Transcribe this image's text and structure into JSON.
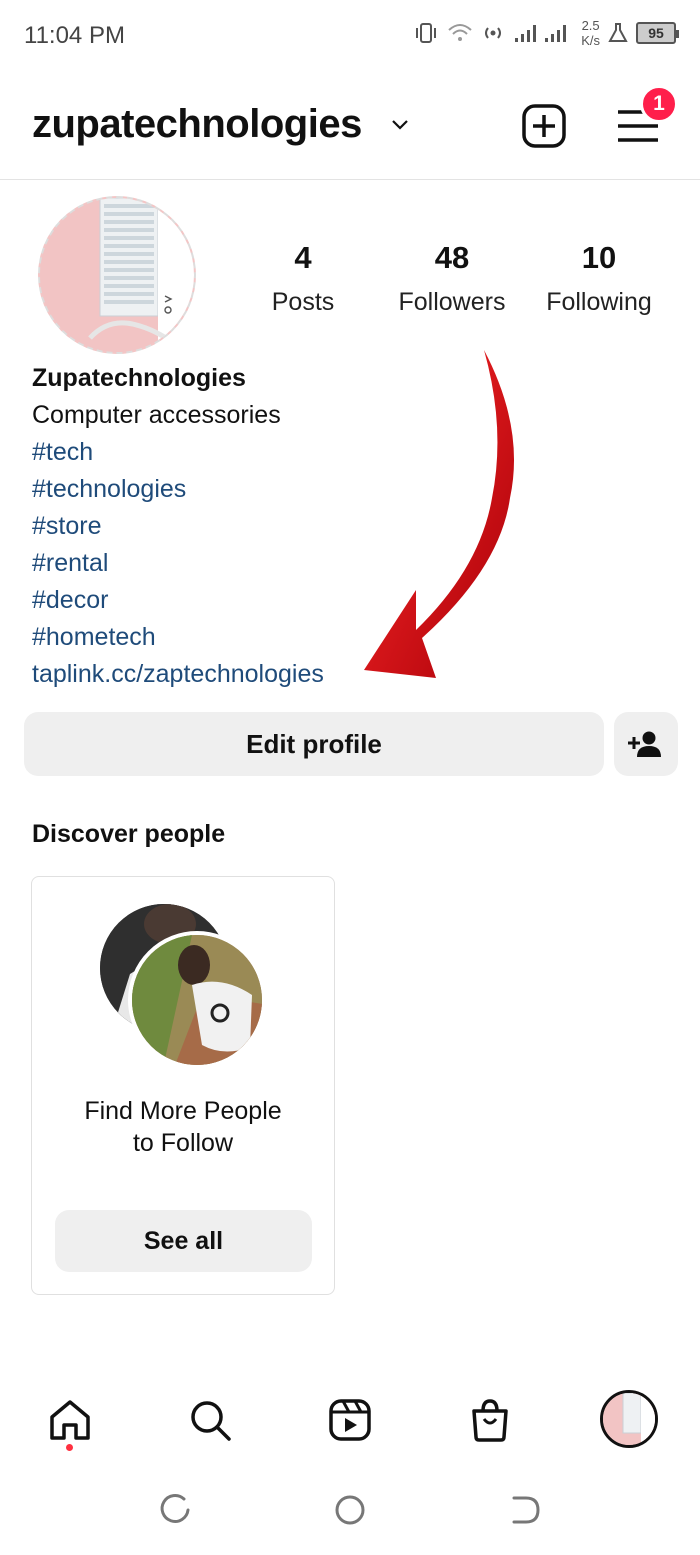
{
  "status_bar": {
    "time": "11:04 PM",
    "net_speed_value": "2.5",
    "net_speed_unit": "K/s",
    "battery": "95"
  },
  "header": {
    "username": "zupatechnologies",
    "notification_count": "1"
  },
  "profile": {
    "stats": [
      {
        "value": "4",
        "label": "Posts"
      },
      {
        "value": "48",
        "label": "Followers"
      },
      {
        "value": "10",
        "label": "Following"
      }
    ],
    "name": "Zupatechnologies",
    "description": "Computer accessories",
    "hashtags": [
      "#tech",
      "#technologies",
      "#store",
      "#rental",
      "#decor",
      "#hometech"
    ],
    "link": "taplink.cc/zaptechnologies",
    "edit_label": "Edit profile"
  },
  "discover": {
    "title": "Discover people",
    "card_line1": "Find More People",
    "card_line2": "to Follow",
    "see_all_label": "See all"
  },
  "colors": {
    "link": "#1f4b7a",
    "badge": "#ff1f4b",
    "annotation_arrow": "#c8000a",
    "button_bg": "#efefef"
  }
}
